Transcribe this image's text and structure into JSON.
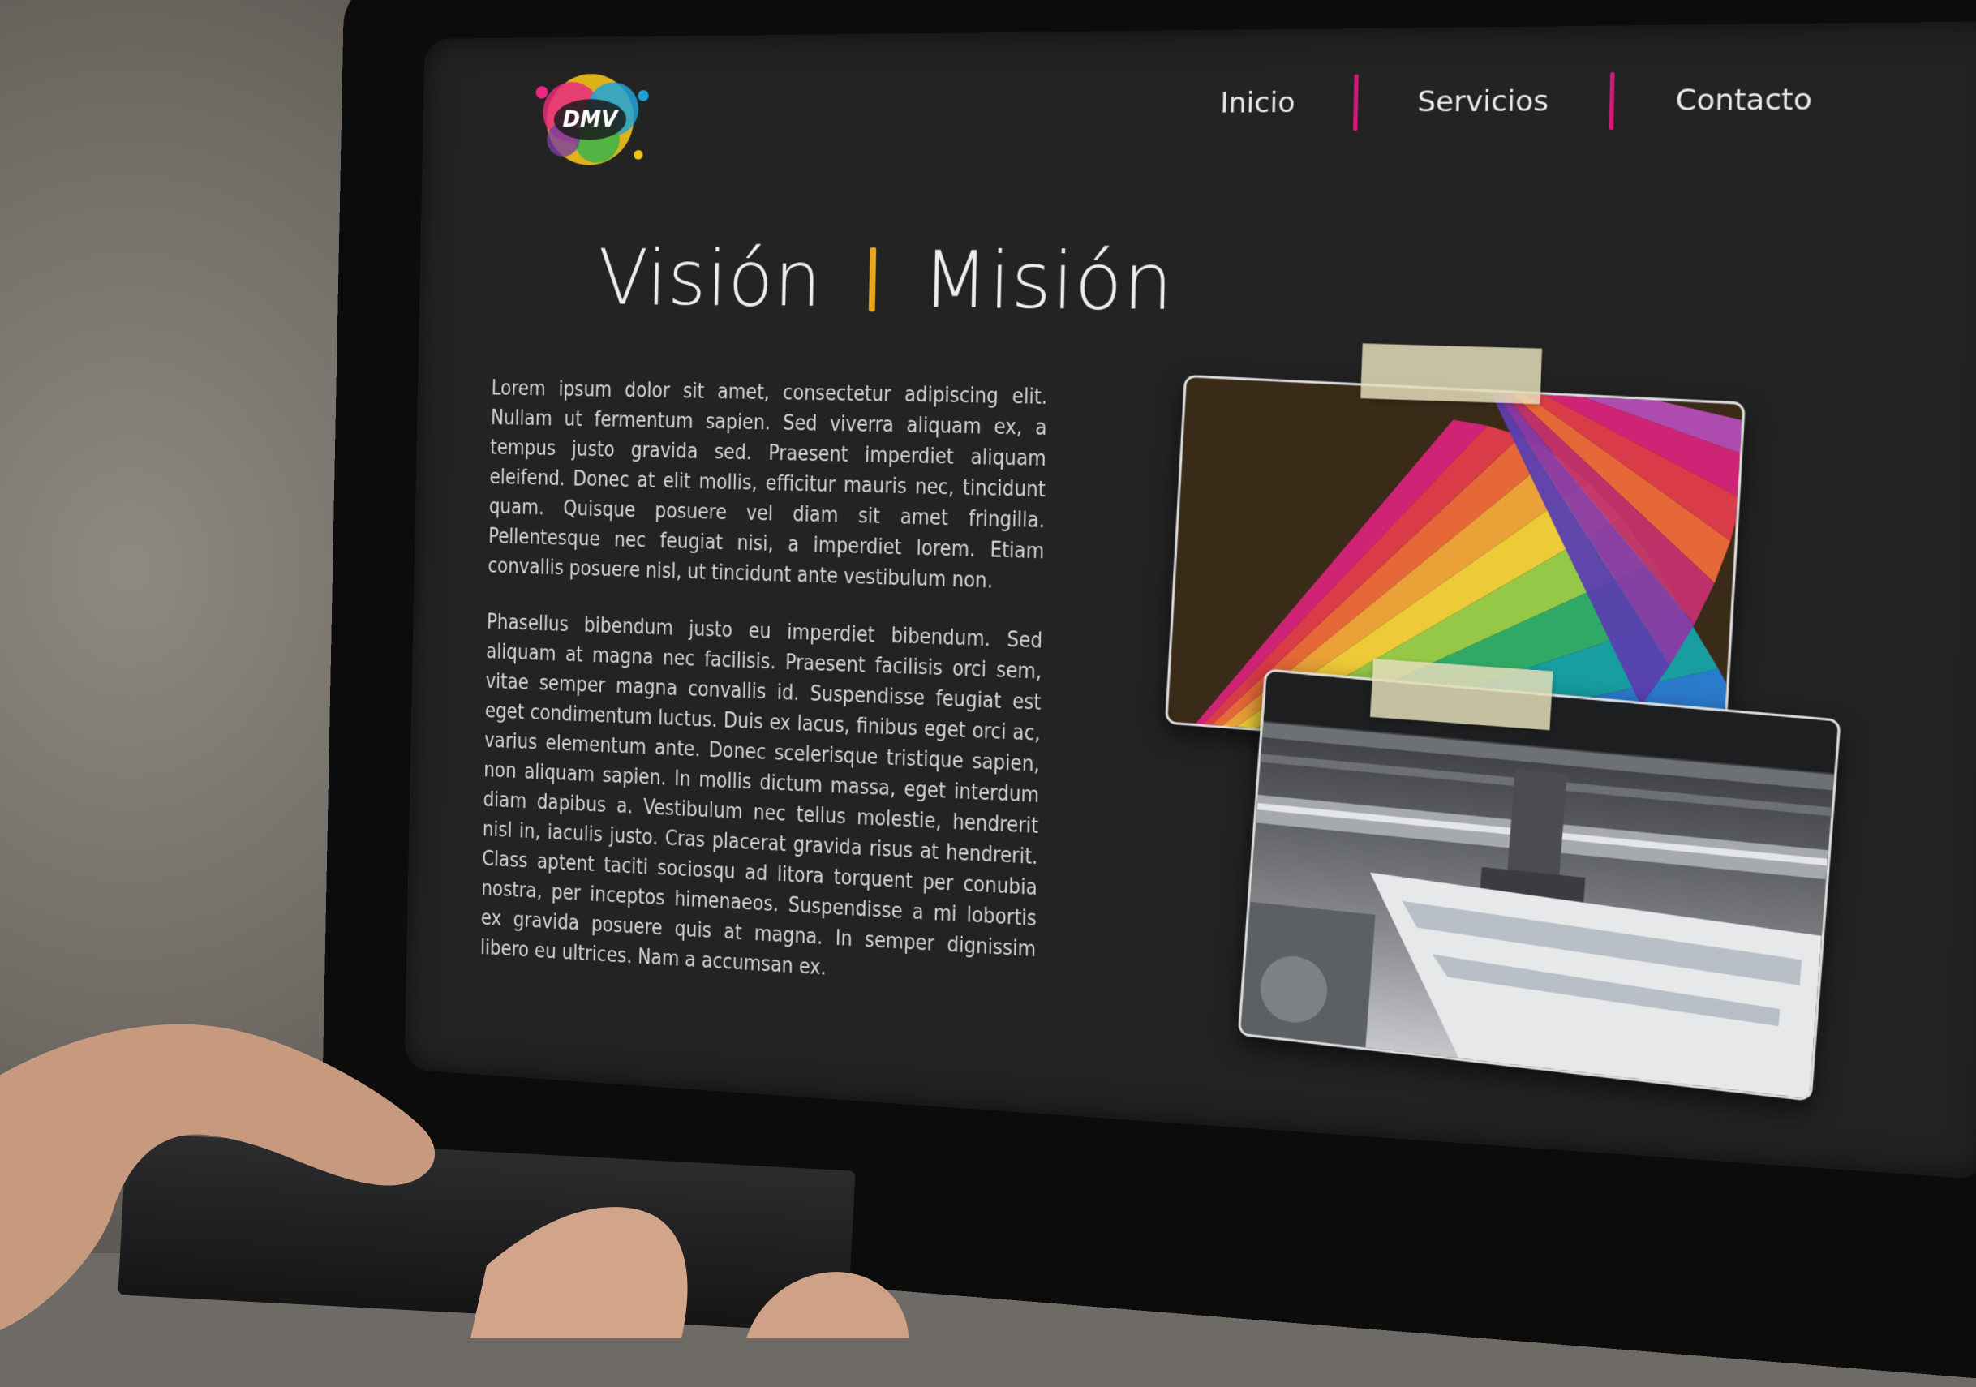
{
  "site": {
    "logo_text": "DMV",
    "nav": {
      "items": [
        "Inicio",
        "Servicios",
        "Contacto"
      ]
    },
    "hero": {
      "title_left": "Visión",
      "title_right": "Misión"
    },
    "content": {
      "paragraph_1": "Lorem ipsum dolor sit amet, consectetur adipiscing elit. Nullam ut fermentum sapien. Sed viverra aliquam ex, a tempus justo gravida sed. Praesent imperdiet aliquam eleifend. Donec at elit mollis, efficitur mauris nec, tincidunt quam. Quisque posuere vel diam sit amet fringilla. Pellentesque nec feugiat nisi, a imperdiet lorem. Etiam convallis posuere nisl, ut tincidunt ante vestibulum non.",
      "paragraph_2": "Phasellus bibendum justo eu imperdiet bibendum. Sed aliquam at magna nec facilisis. Praesent facilisis orci sem, vitae semper magna convallis id. Suspendisse feugiat est eget condimentum luctus. Duis ex lacus, finibus eget orci ac, varius elementum ante. Donec scelerisque tristique sapien, non aliquam sapien. In mollis dictum massa, eget interdum diam dapibus a. Vestibulum nec tellus molestie, hendrerit nisl in, iaculis justo. Cras placerat gravida risus at hendrerit. Class aptent taciti sociosqu ad litora torquent per conubia nostra, per inceptos himenaeos. Suspendisse a mi lobortis ex gravida posuere quis at magna. In semper dignissim libero eu ultrices. Nam a accumsan ex."
    }
  },
  "colors": {
    "page_bg": "#232323",
    "nav_separator": "#d6177a",
    "title_separator": "#e7a51c",
    "text": "#d4d4d4"
  },
  "icons": {
    "logo": "paint-splash-logo",
    "photo_1": "color-swatch-fan-photo",
    "photo_2": "printing-press-photo"
  }
}
